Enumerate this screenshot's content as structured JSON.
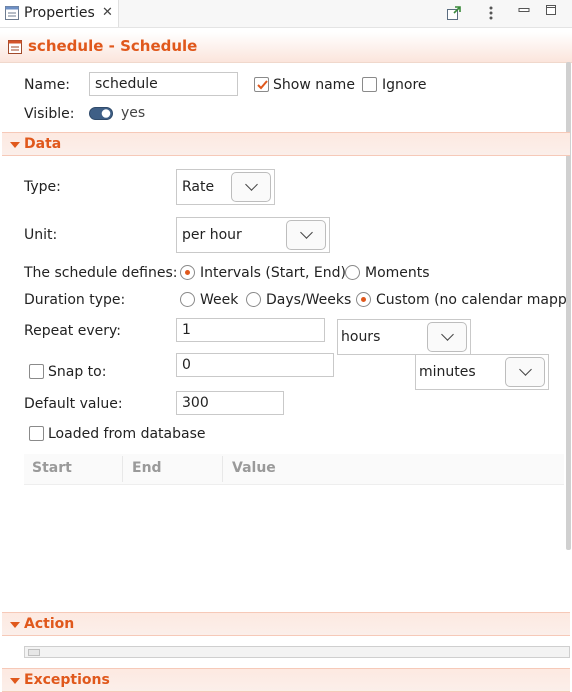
{
  "tab": {
    "title": "Properties",
    "close_symbol": "✕"
  },
  "header": {
    "title": "schedule - Schedule"
  },
  "general": {
    "name_label": "Name:",
    "name_value": "schedule",
    "show_name_label": "Show name",
    "show_name_checked": true,
    "ignore_label": "Ignore",
    "ignore_checked": false,
    "visible_label": "Visible:",
    "visible_value": "yes"
  },
  "sections": {
    "data": "Data",
    "action": "Action",
    "exceptions": "Exceptions"
  },
  "data": {
    "type_label": "Type:",
    "type_value": "Rate",
    "unit_label": "Unit:",
    "unit_value": "per hour",
    "defines_label": "The schedule defines:",
    "defines_options": [
      "Intervals (Start, End)",
      "Moments"
    ],
    "defines_selected": "Intervals (Start, End)",
    "duration_label": "Duration type:",
    "duration_options": [
      "Week",
      "Days/Weeks",
      "Custom (no calendar mappin"
    ],
    "duration_selected": "Custom (no calendar mappin",
    "repeat_label": "Repeat every:",
    "repeat_value": "1",
    "repeat_unit": "hours",
    "snap_label": "Snap to:",
    "snap_checked": false,
    "snap_value": "0",
    "snap_unit": "minutes",
    "default_label": "Default value:",
    "default_value": "300",
    "loaded_label": "Loaded from database",
    "loaded_checked": false,
    "table_columns": [
      "Start",
      "End",
      "Value"
    ]
  },
  "colors": {
    "accent": "#e0581c",
    "section_bg": "#fde9e1",
    "border": "#c9c9c9"
  }
}
